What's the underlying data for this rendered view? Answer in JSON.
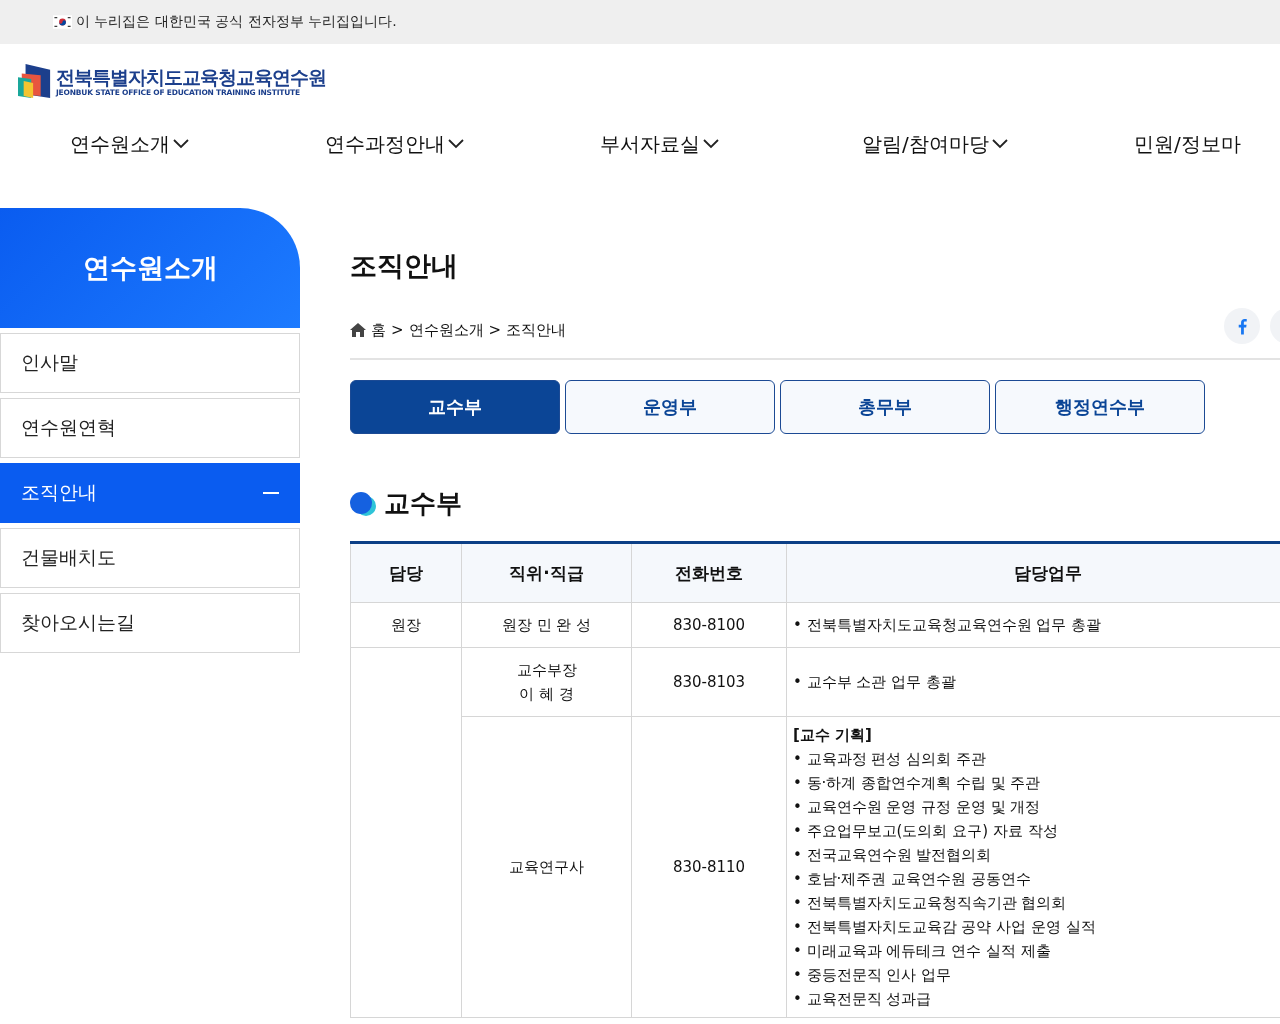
{
  "top_bar": {
    "text": "이 누리집은 대한민국 공식 전자정부 누리집입니다."
  },
  "logo": {
    "title": "전북특별자치도교육청교육연수원",
    "subtitle": "JEONBUK STATE OFFICE OF EDUCATION TRAINING INSTITUTE"
  },
  "nav": [
    {
      "label": "연수원소개",
      "has_caret": true
    },
    {
      "label": "연수과정안내",
      "has_caret": true
    },
    {
      "label": "부서자료실",
      "has_caret": true
    },
    {
      "label": "알림/참여마당",
      "has_caret": true
    },
    {
      "label": "민원/정보마",
      "has_caret": false
    }
  ],
  "sidebar": {
    "title": "연수원소개",
    "items": [
      {
        "label": "인사말",
        "selected": false
      },
      {
        "label": "연수원연혁",
        "selected": false
      },
      {
        "label": "조직안내",
        "selected": true
      },
      {
        "label": "건물배치도",
        "selected": false
      },
      {
        "label": "찾아오시는길",
        "selected": false
      }
    ]
  },
  "page_title": "조직안내",
  "breadcrumb": [
    "홈",
    "연수원소개",
    "조직안내"
  ],
  "breadcrumb_separator": ">",
  "tabs": [
    {
      "label": "교수부",
      "selected": true
    },
    {
      "label": "운영부",
      "selected": false
    },
    {
      "label": "총무부",
      "selected": false
    },
    {
      "label": "행정연수부",
      "selected": false
    }
  ],
  "section_title": "교수부",
  "table": {
    "columns": [
      "담당",
      "직위·직급",
      "전화번호",
      "담당업무"
    ],
    "groups": [
      {
        "role": "원장",
        "members": [
          {
            "position": [
              "원장 민 완 성"
            ],
            "phone": "830-8100",
            "duties": [
              "• 전북특별자치도교육청교육연수원 업무 총괄"
            ]
          }
        ]
      },
      {
        "members": [
          {
            "position": [
              "교수부장",
              "이 혜 경"
            ],
            "phone": "830-8103",
            "duties": [
              "• 교수부 소관 업무 총괄"
            ]
          },
          {
            "position": [
              "교육연구사"
            ],
            "phone": "830-8110",
            "duty_heading": "[교수 기획]",
            "duties": [
              "• 교육과정 편성 심의회 주관",
              "• 동·하계 종합연수계획 수립 및 주관",
              "• 교육연수원 운영 규정 운영 및 개정",
              "• 주요업무보고(도의회 요구) 자료 작성",
              "• 전국교육연수원 발전협의회",
              "• 호남·제주권 교육연수원 공동연수",
              "• 전북특별자치도교육청직속기관 협의회",
              "• 전북특별자치도교육감 공약 사업 운영 실적",
              "• 미래교육과 에듀테크 연수 실적 제출",
              "• 중등전문직 인사 업무",
              "• 교육전문직 성과급"
            ]
          }
        ]
      }
    ]
  }
}
